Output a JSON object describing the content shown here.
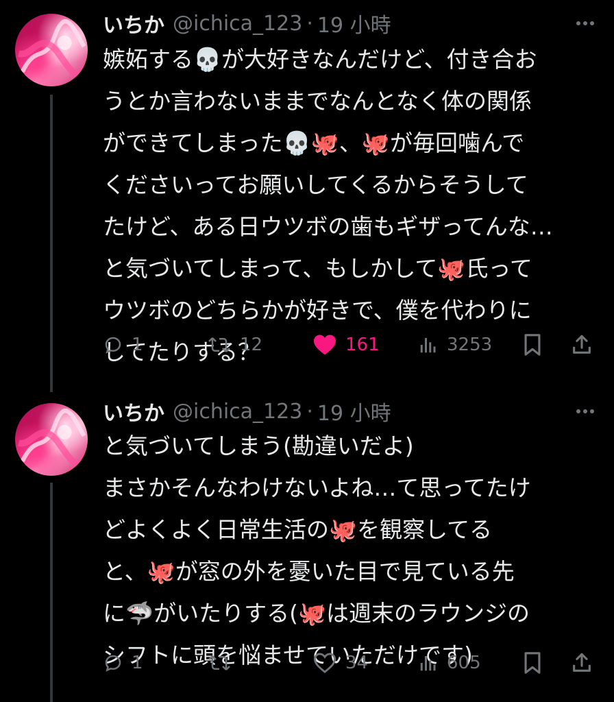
{
  "tweets": [
    {
      "author": {
        "name": "いちか",
        "handle": "@ichica_123",
        "separator": "·",
        "time": "19 小時"
      },
      "lines": [
        "嫉妬する💀が大好きなんだけど、付き合お",
        "うとか言わないままでなんとなく体の関係",
        "ができてしまった💀🐙、🐙が毎回噛んで",
        "くださいってお願いしてくるからそうして",
        "たけど、ある日ウツボの歯もギザってんな…",
        "と気づいてしまって、もしかして🐙氏って",
        "ウツボのどちらかが好きで、僕を代わりに",
        "してたりする？"
      ],
      "stats": {
        "replies": "1",
        "retweets": "12",
        "likes": "161",
        "views": "3253"
      },
      "liked": true
    },
    {
      "author": {
        "name": "いちか",
        "handle": "@ichica_123",
        "separator": "·",
        "time": "19 小時"
      },
      "lines": [
        "と気づいてしまう(勘違いだよ)",
        "まさかそんなわけないよね…て思ってたけ",
        "どよくよく日常生活の🐙を観察してる",
        "と、🐙が窓の外を憂いた目で見ている先",
        "に🦈がいたりする(🐙は週末のラウンジの",
        "シフトに頭を悩ませていただけです)"
      ],
      "stats": {
        "replies": "1",
        "retweets": "",
        "likes": "34",
        "views": "605"
      },
      "liked": false
    }
  ],
  "colors": {
    "background": "#000000",
    "text": "#e7e9ea",
    "muted": "#71767b",
    "like_active": "#f91880",
    "thread_line": "#333639"
  }
}
